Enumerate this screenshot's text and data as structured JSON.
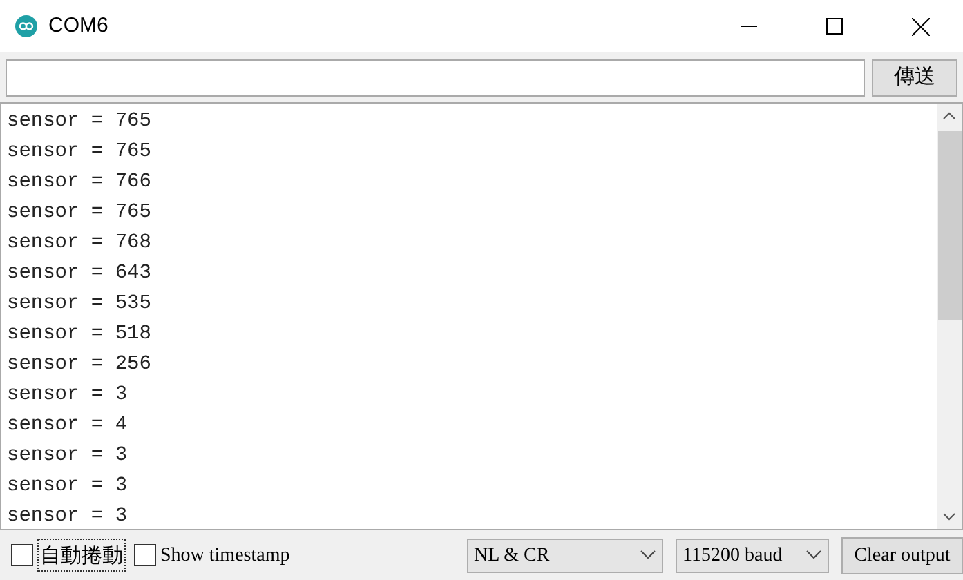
{
  "window": {
    "title": "COM6"
  },
  "send": {
    "button": "傳送"
  },
  "output": {
    "lines": [
      "sensor = 765",
      "sensor = 765",
      "sensor = 766",
      "sensor = 765",
      "sensor = 768",
      "sensor = 643",
      "sensor = 535",
      "sensor = 518",
      "sensor = 256",
      "sensor = 3",
      "sensor = 4",
      "sensor = 3",
      "sensor = 3",
      "sensor = 3"
    ]
  },
  "footer": {
    "autoscroll": {
      "label": "自動捲動",
      "checked": false
    },
    "timestamp": {
      "label": "Show timestamp",
      "checked": false
    },
    "line_ending": "NL & CR",
    "baud": "115200 baud",
    "clear_button": "Clear output"
  }
}
